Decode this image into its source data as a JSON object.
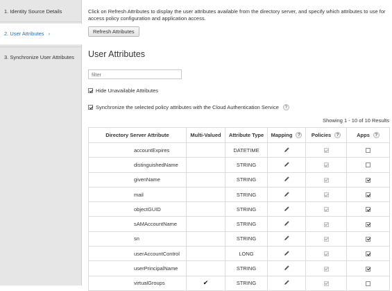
{
  "sidebar": {
    "items": [
      {
        "label": "1. Identity Source Details"
      },
      {
        "label": "2. User Attributes",
        "chevron": "›"
      },
      {
        "label": "3. Synchronize User Attributes"
      }
    ]
  },
  "intro": "Click on Refresh Attributes to display the user attributes available from the directory server, and specify which attributes to use for access policy configuration and application access.",
  "refresh_label": "Refresh Attributes",
  "section_title": "User Attributes",
  "filter_placeholder": "filter",
  "hide_unavailable_label": "Hide Unavailable Attributes",
  "sync_label": "Synchronize the selected policy attributes with the Cloud Authentication Service",
  "help_glyph": "?",
  "showing": "Showing 1 - 10 of 10 Results",
  "table": {
    "headers": [
      "Directory Server Attribute",
      "Multi-Valued",
      "Attribute Type",
      "Mapping",
      "Policies",
      "Apps"
    ],
    "rows": [
      {
        "name": "accountExpires",
        "multi": "",
        "type": "DATETIME",
        "policies": true,
        "apps": false
      },
      {
        "name": "distinguishedName",
        "multi": "",
        "type": "STRING",
        "policies": true,
        "apps": false
      },
      {
        "name": "givenName",
        "multi": "",
        "type": "STRING",
        "policies": true,
        "apps": true
      },
      {
        "name": "mail",
        "multi": "",
        "type": "STRING",
        "policies": true,
        "apps": true
      },
      {
        "name": "objectGUID",
        "multi": "",
        "type": "STRING",
        "policies": true,
        "apps": true
      },
      {
        "name": "sAMAccountName",
        "multi": "",
        "type": "STRING",
        "policies": true,
        "apps": true
      },
      {
        "name": "sn",
        "multi": "",
        "type": "STRING",
        "policies": true,
        "apps": true
      },
      {
        "name": "userAccountControl",
        "multi": "",
        "type": "LONG",
        "policies": true,
        "apps": true
      },
      {
        "name": "userPrincipalName",
        "multi": "",
        "type": "STRING",
        "policies": true,
        "apps": true
      },
      {
        "name": "virtualGroups",
        "multi": "✔",
        "type": "STRING",
        "policies": true,
        "apps": false
      }
    ]
  }
}
